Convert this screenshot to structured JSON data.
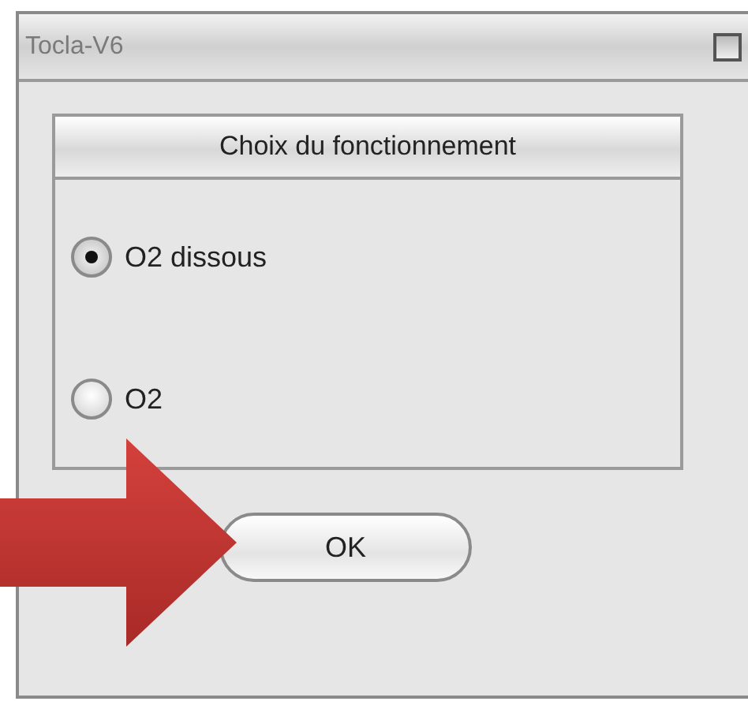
{
  "window": {
    "title": "Tocla-V6"
  },
  "group": {
    "title": "Choix du fonctionnement"
  },
  "options": [
    {
      "label": "O2 dissous",
      "selected": true
    },
    {
      "label": "O2",
      "selected": false
    }
  ],
  "buttons": [
    "OK"
  ]
}
